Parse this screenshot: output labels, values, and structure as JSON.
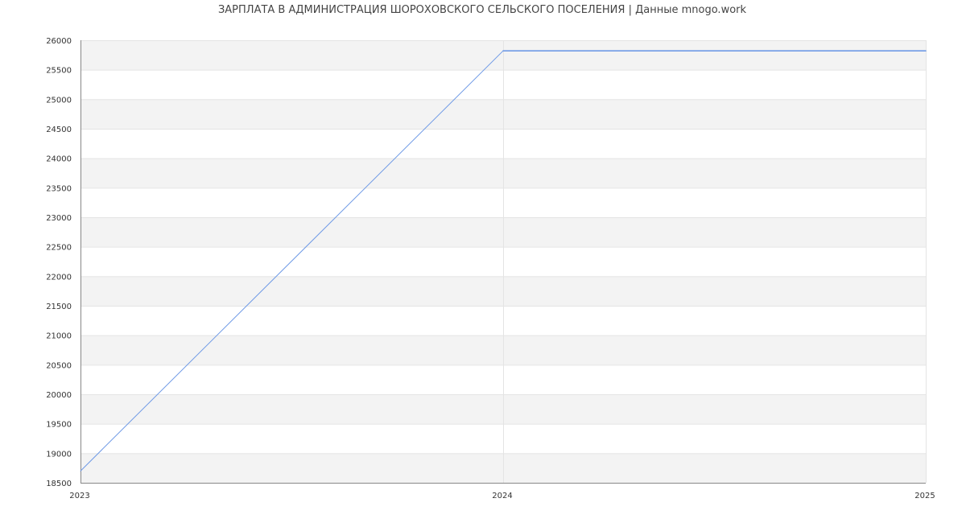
{
  "chart_data": {
    "type": "line",
    "title": "ЗАРПЛАТА В АДМИНИСТРАЦИЯ ШОРОХОВСКОГО СЕЛЬСКОГО ПОСЕЛЕНИЯ | Данные mnogo.work",
    "xlabel": "",
    "ylabel": "",
    "x": [
      "2023",
      "2024",
      "2025"
    ],
    "xlim": [
      2023,
      2025
    ],
    "ylim": [
      18500,
      26000
    ],
    "y_ticks": [
      "18500",
      "19000",
      "19500",
      "20000",
      "20500",
      "21000",
      "21500",
      "22000",
      "22500",
      "23000",
      "23500",
      "24000",
      "24500",
      "25000",
      "25500",
      "26000"
    ],
    "x_ticks": [
      "2023",
      "2024",
      "2025"
    ],
    "grid": true,
    "legend": "none",
    "series": [
      {
        "values": [
          18700,
          25820,
          25820
        ],
        "color": "#6f9ae6"
      }
    ],
    "band_color": "#f3f3f3",
    "grid_color": "#e4e4e4",
    "axis_color": "#888888"
  }
}
